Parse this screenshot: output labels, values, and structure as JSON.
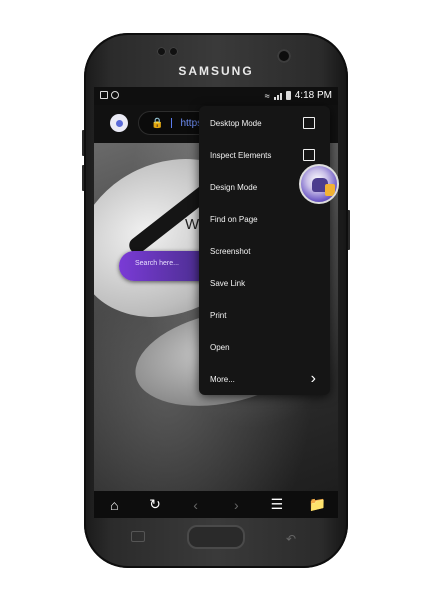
{
  "device": {
    "brand": "SAMSUNG"
  },
  "status_bar": {
    "time": "4:18 PM",
    "icons": [
      "image-icon",
      "messenger-icon",
      "wifi-icon",
      "signal-icon",
      "battery-icon"
    ]
  },
  "browser": {
    "url": "https://",
    "bottom_nav": [
      "home-icon",
      "refresh-icon",
      "back-icon",
      "forward-icon",
      "menu-icon",
      "add-folder-icon"
    ]
  },
  "page": {
    "heading": "W",
    "search_placeholder": "Search here..."
  },
  "menu": {
    "items": [
      {
        "label": "Desktop Mode",
        "control": "checkbox",
        "checked": false
      },
      {
        "label": "Inspect Elements",
        "control": "checkbox",
        "checked": false
      },
      {
        "label": "Design Mode"
      },
      {
        "label": "Find on Page"
      },
      {
        "label": "Screenshot"
      },
      {
        "label": "Save Link"
      },
      {
        "label": "Print"
      },
      {
        "label": "Open"
      },
      {
        "label": "More...",
        "control": "chevron"
      }
    ]
  },
  "colors": {
    "accent": "#6f8ef6",
    "menu_bg": "#151515",
    "search_gradient_start": "#7a3bd6"
  }
}
